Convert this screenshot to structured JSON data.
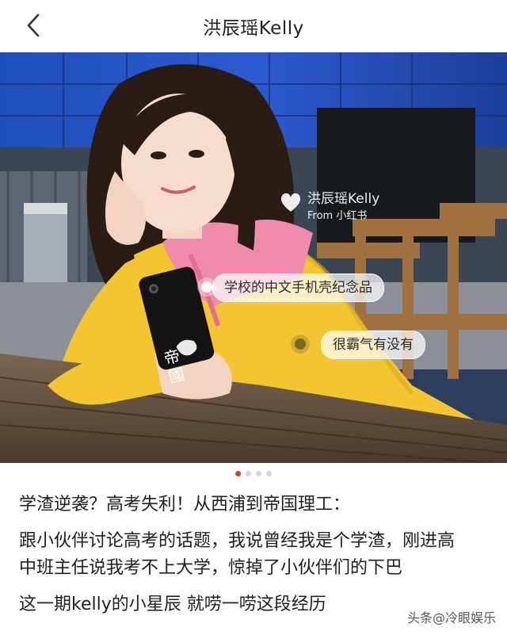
{
  "header": {
    "title": "洪辰瑶Kelly"
  },
  "photo": {
    "watermark_name": "洪辰瑶Kelly",
    "watermark_source": "From 小红书",
    "phone_text": "帝國",
    "tags": [
      {
        "label": "学校的中文手机壳纪念品"
      },
      {
        "label": "很霸气有没有"
      }
    ]
  },
  "carousel": {
    "count": 4,
    "active_index": 0
  },
  "article": {
    "headline": "学渣逆袭？高考失利！从西浦到帝国理工：",
    "para1_line1": "跟小伙伴讨论高考的话题，我说曾经我是个学渣，刚进高",
    "para1_line2": "中班主任说我考不上大学，惊掉了小伙伴们的下巴",
    "para2": "这一期kelly的小星辰 就唠一唠这段经历"
  },
  "watermark_footer": "头条@冷眼娱乐",
  "colors": {
    "accent": "#e5343e",
    "jacket": "#f2c531",
    "hoodie": "#f08bab"
  }
}
